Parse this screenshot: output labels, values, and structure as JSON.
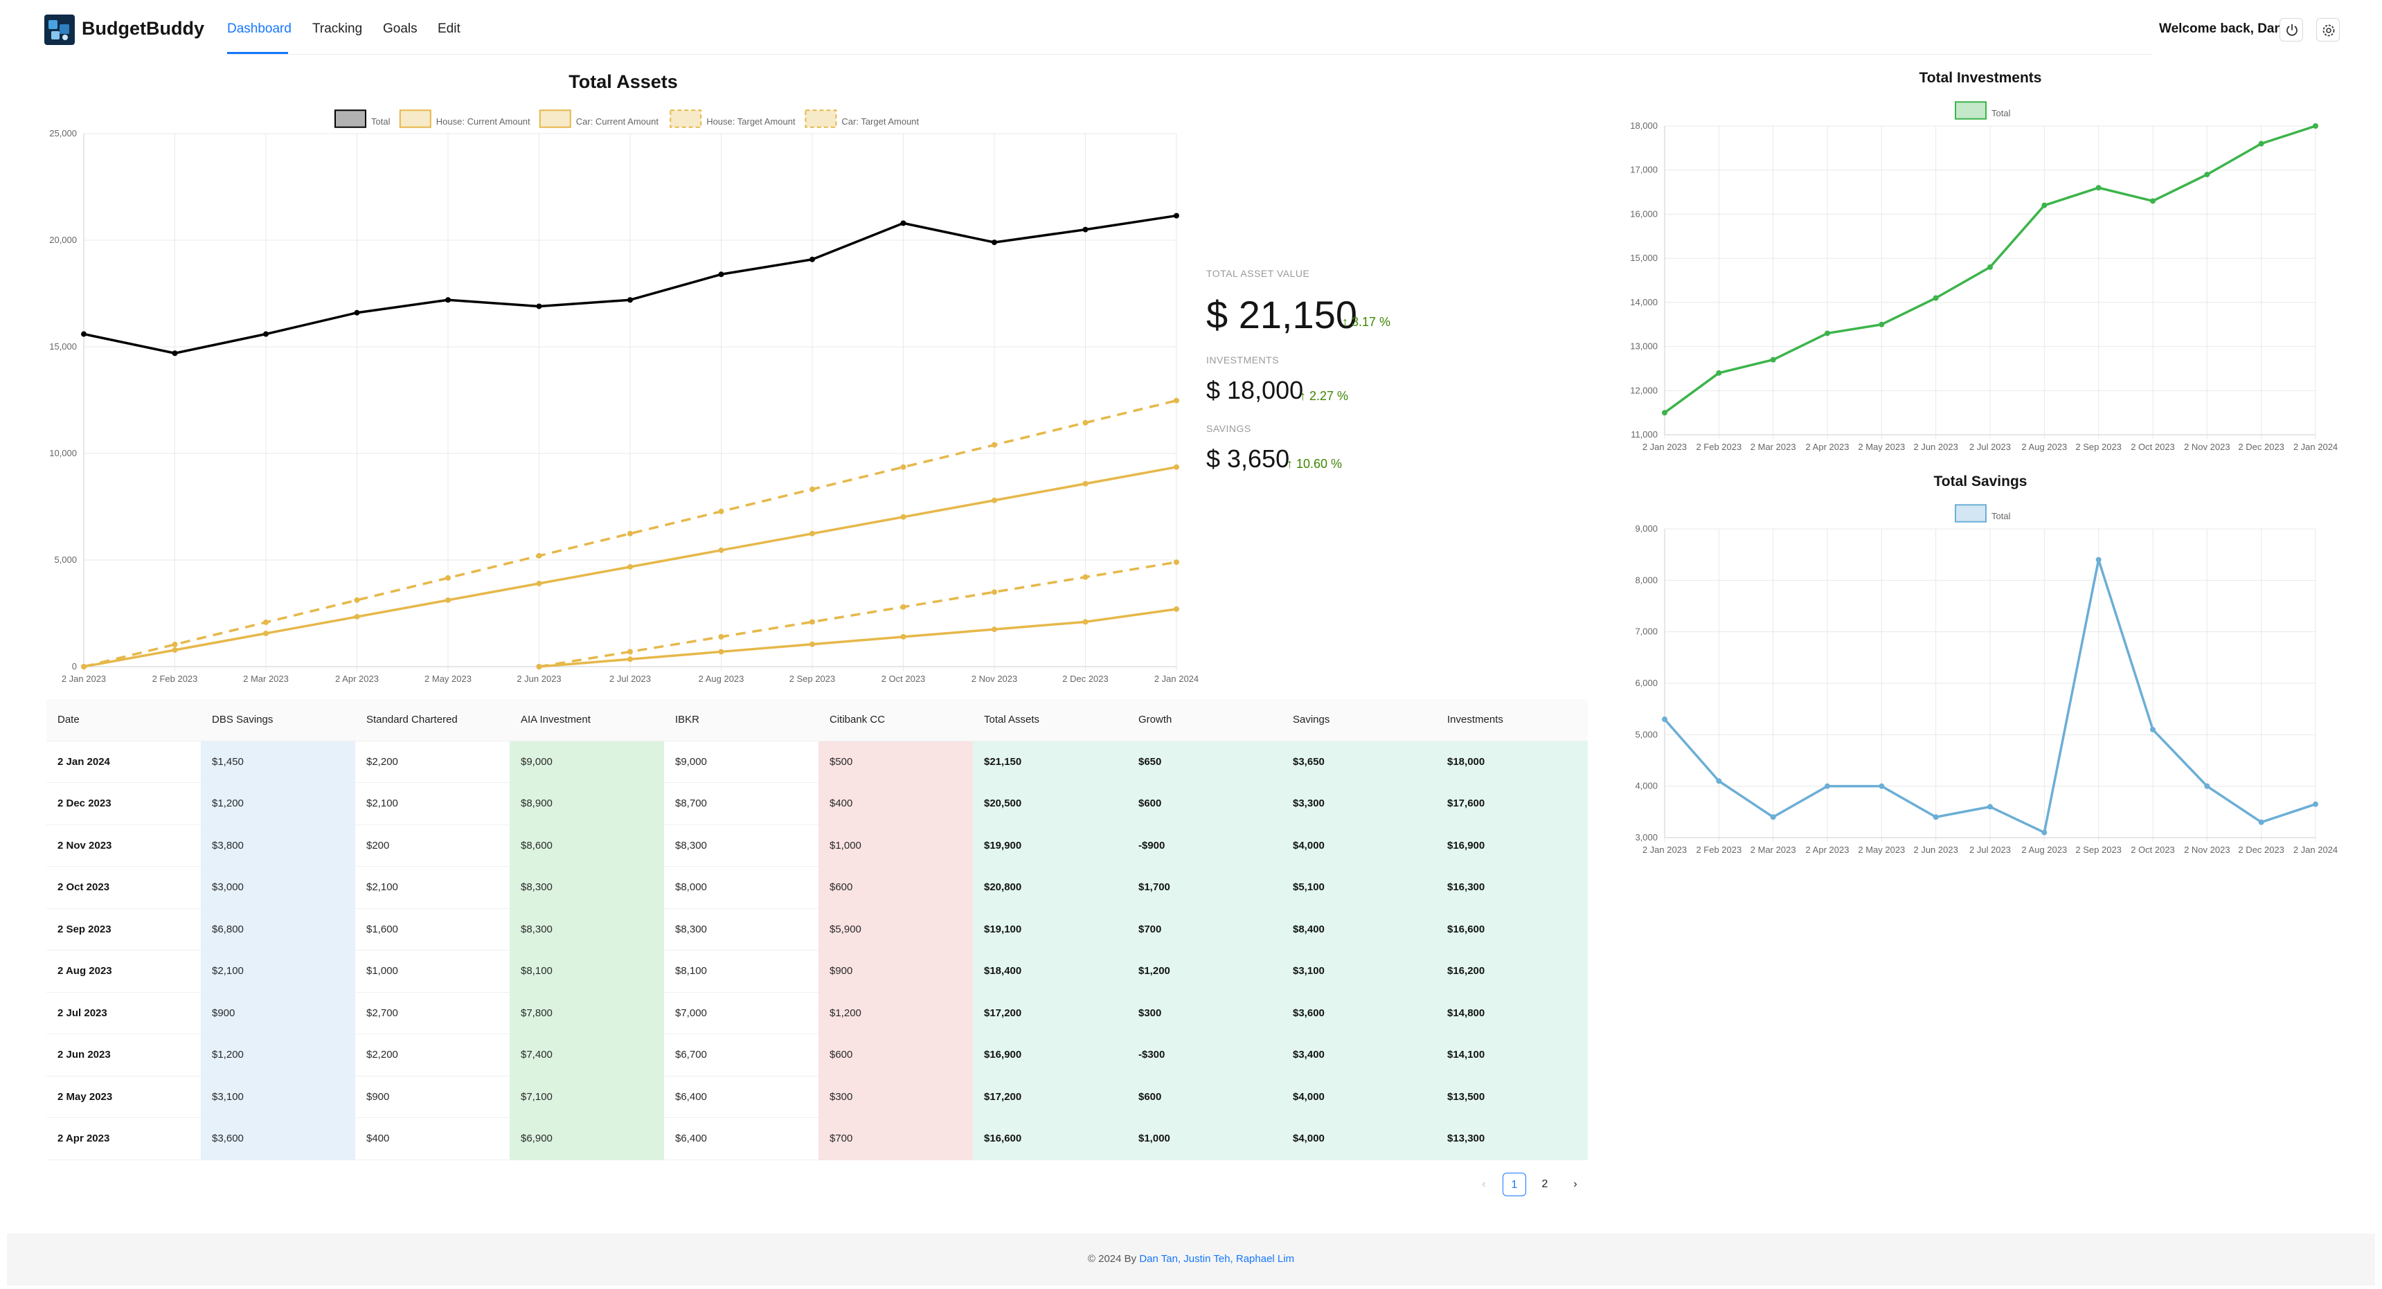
{
  "header": {
    "brand": "BudgetBuddy",
    "nav": [
      "Dashboard",
      "Tracking",
      "Goals",
      "Edit"
    ],
    "active_nav": "Dashboard",
    "welcome": "Welcome back, Dan",
    "icons": [
      "power-icon",
      "settings-icon"
    ]
  },
  "stats": {
    "total_label": "TOTAL ASSET VALUE",
    "total_value": "$ 21,150",
    "total_change": "3.17 %",
    "investments_label": "INVESTMENTS",
    "investments_value": "$ 18,000",
    "investments_change": "2.27 %",
    "savings_label": "SAVINGS",
    "savings_value": "$ 3,650",
    "savings_change": "10.60 %"
  },
  "colors": {
    "accent": "#1677ff",
    "positive": "#3f8600",
    "total_line": "#000000",
    "goal_line": "#e6b84a",
    "investments_line": "#3cb44b",
    "savings_line": "#6baed6",
    "dbs_cell": "#e6f1fa",
    "aia_cell": "#dcf3e0",
    "citi_cell": "#f9e3e3",
    "totals_cell": "#e3f7f0"
  },
  "chart_data": [
    {
      "type": "line",
      "title": "Total Assets",
      "x": [
        "2 Jan 2023",
        "2 Feb 2023",
        "2 Mar 2023",
        "2 Apr 2023",
        "2 May 2023",
        "2 Jun 2023",
        "2 Jul 2023",
        "2 Aug 2023",
        "2 Sep 2023",
        "2 Oct 2023",
        "2 Nov 2023",
        "2 Dec 2023",
        "2 Jan 2024"
      ],
      "ylim": [
        0,
        25000
      ],
      "yticks": [
        0,
        5000,
        10000,
        15000,
        20000,
        25000
      ],
      "yticklabels": [
        "0",
        "5,000",
        "10,000",
        "15,000",
        "20,000",
        "25,000"
      ],
      "grid": true,
      "legend_position": "top",
      "series": [
        {
          "name": "Total",
          "style": "solid",
          "color": "#000000",
          "values": [
            15600,
            14700,
            15600,
            16600,
            17200,
            16900,
            17200,
            18400,
            19100,
            20800,
            19900,
            20500,
            21150
          ]
        },
        {
          "name": "House: Current Amount",
          "style": "solid",
          "color": "#e6b84a",
          "values": [
            0,
            780,
            1560,
            2340,
            3120,
            3900,
            4680,
            5460,
            6240,
            7020,
            7800,
            8580,
            9360
          ]
        },
        {
          "name": "Car: Current Amount",
          "style": "solid",
          "color": "#e6b84a",
          "values": [
            null,
            null,
            null,
            null,
            null,
            0,
            350,
            700,
            1050,
            1400,
            1750,
            2100,
            2700
          ]
        },
        {
          "name": "House: Target Amount",
          "style": "dashed",
          "color": "#e6b84a",
          "values": [
            0,
            1040,
            2080,
            3120,
            4160,
            5200,
            6240,
            7280,
            8320,
            9360,
            10400,
            11440,
            12480
          ]
        },
        {
          "name": "Car: Target Amount",
          "style": "dashed",
          "color": "#e6b84a",
          "values": [
            null,
            null,
            null,
            null,
            null,
            0,
            700,
            1400,
            2100,
            2800,
            3500,
            4200,
            4900
          ]
        }
      ]
    },
    {
      "type": "line",
      "title": "Total Investments",
      "x": [
        "2 Jan 2023",
        "2 Feb 2023",
        "2 Mar 2023",
        "2 Apr 2023",
        "2 May 2023",
        "2 Jun 2023",
        "2 Jul 2023",
        "2 Aug 2023",
        "2 Sep 2023",
        "2 Oct 2023",
        "2 Nov 2023",
        "2 Dec 2023",
        "2 Jan 2024"
      ],
      "ylim": [
        11000,
        18000
      ],
      "yticks": [
        11000,
        12000,
        13000,
        14000,
        15000,
        16000,
        17000,
        18000
      ],
      "yticklabels": [
        "11,000",
        "12,000",
        "13,000",
        "14,000",
        "15,000",
        "16,000",
        "17,000",
        "18,000"
      ],
      "grid": true,
      "legend_position": "top",
      "series": [
        {
          "name": "Total",
          "color": "#3cb44b",
          "values": [
            11500,
            12400,
            12700,
            13300,
            13500,
            14100,
            14800,
            16200,
            16600,
            16300,
            16900,
            17600,
            18000
          ]
        }
      ]
    },
    {
      "type": "line",
      "title": "Total Savings",
      "x": [
        "2 Jan 2023",
        "2 Feb 2023",
        "2 Mar 2023",
        "2 Apr 2023",
        "2 May 2023",
        "2 Jun 2023",
        "2 Jul 2023",
        "2 Aug 2023",
        "2 Sep 2023",
        "2 Oct 2023",
        "2 Nov 2023",
        "2 Dec 2023",
        "2 Jan 2024"
      ],
      "ylim": [
        3000,
        9000
      ],
      "yticks": [
        3000,
        4000,
        5000,
        6000,
        7000,
        8000,
        9000
      ],
      "yticklabels": [
        "3,000",
        "4,000",
        "5,000",
        "6,000",
        "7,000",
        "8,000",
        "9,000"
      ],
      "grid": true,
      "legend_position": "top",
      "series": [
        {
          "name": "Total",
          "color": "#6baed6",
          "values": [
            5300,
            4100,
            3400,
            4000,
            4000,
            3400,
            3600,
            3100,
            8400,
            5100,
            4000,
            3300,
            3650
          ]
        }
      ]
    }
  ],
  "table": {
    "columns": [
      "Date",
      "DBS Savings",
      "Standard Chartered",
      "AIA Investment",
      "IBKR",
      "Citibank CC",
      "Total Assets",
      "Growth",
      "Savings",
      "Investments"
    ],
    "rows": [
      [
        "2 Jan 2024",
        "$1,450",
        "$2,200",
        "$9,000",
        "$9,000",
        "$500",
        "$21,150",
        "$650",
        "$3,650",
        "$18,000"
      ],
      [
        "2 Dec 2023",
        "$1,200",
        "$2,100",
        "$8,900",
        "$8,700",
        "$400",
        "$20,500",
        "$600",
        "$3,300",
        "$17,600"
      ],
      [
        "2 Nov 2023",
        "$3,800",
        "$200",
        "$8,600",
        "$8,300",
        "$1,000",
        "$19,900",
        "-$900",
        "$4,000",
        "$16,900"
      ],
      [
        "2 Oct 2023",
        "$3,000",
        "$2,100",
        "$8,300",
        "$8,000",
        "$600",
        "$20,800",
        "$1,700",
        "$5,100",
        "$16,300"
      ],
      [
        "2 Sep 2023",
        "$6,800",
        "$1,600",
        "$8,300",
        "$8,300",
        "$5,900",
        "$19,100",
        "$700",
        "$8,400",
        "$16,600"
      ],
      [
        "2 Aug 2023",
        "$2,100",
        "$1,000",
        "$8,100",
        "$8,100",
        "$900",
        "$18,400",
        "$1,200",
        "$3,100",
        "$16,200"
      ],
      [
        "2 Jul 2023",
        "$900",
        "$2,700",
        "$7,800",
        "$7,000",
        "$1,200",
        "$17,200",
        "$300",
        "$3,600",
        "$14,800"
      ],
      [
        "2 Jun 2023",
        "$1,200",
        "$2,200",
        "$7,400",
        "$6,700",
        "$600",
        "$16,900",
        "-$300",
        "$3,400",
        "$14,100"
      ],
      [
        "2 May 2023",
        "$3,100",
        "$900",
        "$7,100",
        "$6,400",
        "$300",
        "$17,200",
        "$600",
        "$4,000",
        "$13,500"
      ],
      [
        "2 Apr 2023",
        "$3,600",
        "$400",
        "$6,900",
        "$6,400",
        "$700",
        "$16,600",
        "$1,000",
        "$4,000",
        "$13,300"
      ]
    ]
  },
  "pagination": {
    "pages": [
      "1",
      "2"
    ],
    "current": "1",
    "prev": "‹",
    "next": "›"
  },
  "footer": {
    "prefix": "© 2024 By",
    "authors": "Dan Tan, Justin Teh, Raphael Lim"
  }
}
